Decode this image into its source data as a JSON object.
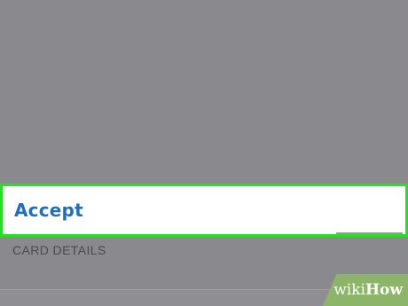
{
  "action_sheet": {
    "accept_label": "Accept"
  },
  "section": {
    "header": "CARD DETAILS"
  },
  "watermark": {
    "wiki": "wiki",
    "how": "How"
  },
  "colors": {
    "overlay": "#8a8a8e",
    "highlight": "#25e021",
    "accept_text": "#1f6fbf"
  }
}
